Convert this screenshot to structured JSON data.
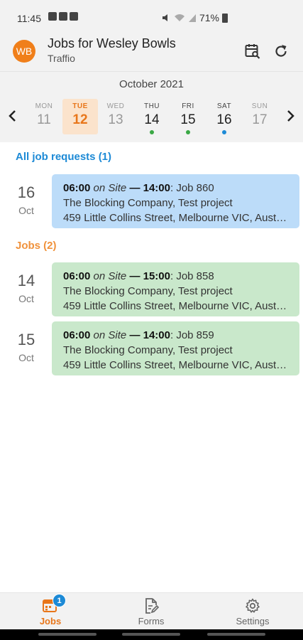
{
  "status": {
    "time": "11:45",
    "battery": "71%"
  },
  "appbar": {
    "avatar_initials": "WB",
    "title": "Jobs for Wesley Bowls",
    "subtitle": "Traffio"
  },
  "calendar": {
    "month": "October 2021",
    "days": [
      {
        "name": "MON",
        "num": "11"
      },
      {
        "name": "TUE",
        "num": "12"
      },
      {
        "name": "WED",
        "num": "13"
      },
      {
        "name": "THU",
        "num": "14"
      },
      {
        "name": "FRI",
        "num": "15"
      },
      {
        "name": "SAT",
        "num": "16"
      },
      {
        "name": "SUN",
        "num": "17"
      }
    ],
    "dot_colors": {
      "green": "#3aa845",
      "blue": "#1d8ad6"
    }
  },
  "sections": {
    "requests": "All job requests (1)",
    "jobs": "Jobs (2)"
  },
  "requests": [
    {
      "day": "16",
      "month": "Oct",
      "start": "06:00",
      "on": "on",
      "site": "Site",
      "dash": "—",
      "end": "14:00",
      "job": ": Job 860",
      "client": "The Blocking Company, Test project",
      "address": "459 Little Collins Street, Melbourne VIC, Australia"
    }
  ],
  "jobs": [
    {
      "day": "14",
      "month": "Oct",
      "start": "06:00",
      "on": "on",
      "site": "Site",
      "dash": "—",
      "end": "15:00",
      "job": ": Job 858",
      "client": "The Blocking Company, Test project",
      "address": "459 Little Collins Street, Melbourne VIC, Australia"
    },
    {
      "day": "15",
      "month": "Oct",
      "start": "06:00",
      "on": "on",
      "site": "Site",
      "dash": "—",
      "end": "14:00",
      "job": ": Job 859",
      "client": "The Blocking Company, Test project",
      "address": "459 Little Collins Street, Melbourne VIC, Australia"
    }
  ],
  "bottomnav": {
    "jobs": "Jobs",
    "jobs_badge": "1",
    "forms": "Forms",
    "settings": "Settings"
  },
  "colors": {
    "accent": "#e8761a",
    "request_card": "#bcdcf9",
    "job_card": "#c9e8cb",
    "link_blue": "#1d8ad6"
  },
  "icons": {
    "calendar_search": "calendar-search-icon",
    "refresh": "refresh-icon",
    "prev": "chevron-left-icon",
    "next": "chevron-right-icon",
    "jobs": "calendar-icon",
    "forms": "form-edit-icon",
    "settings": "gear-icon"
  }
}
